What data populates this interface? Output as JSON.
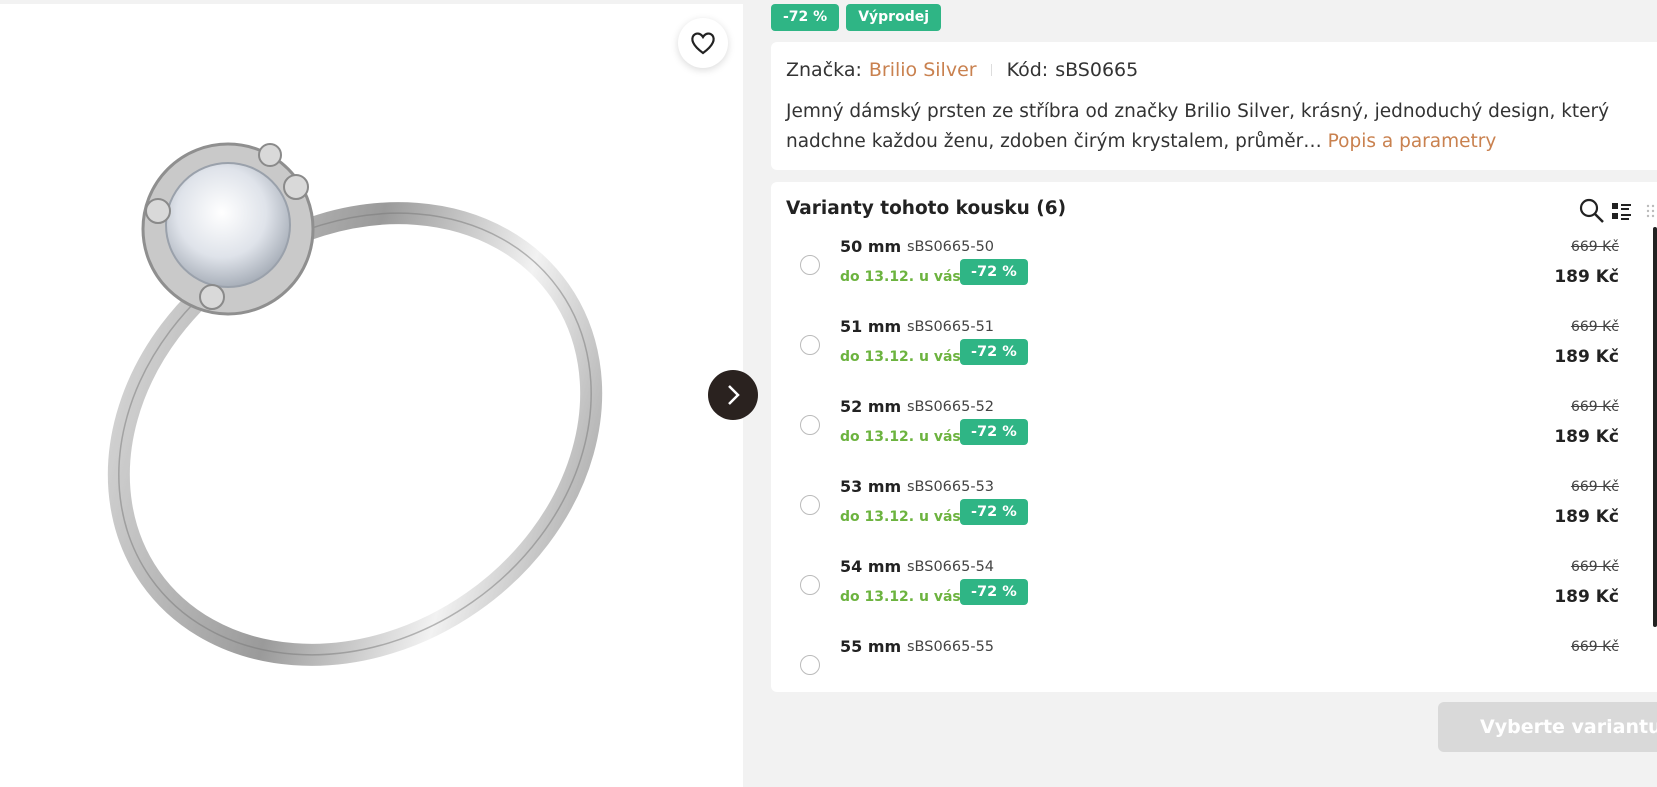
{
  "badges": [
    "-72 %",
    "Výprodej"
  ],
  "product": {
    "brand_label": "Značka:",
    "brand_name": "Brilio Silver",
    "code_label": "Kód:",
    "code_value": "sBS0665",
    "description": "Jemný dámský prsten ze stříbra od značky Brilio Silver, krásný, jednoduchý design, který nadchne každou ženu, zdoben čirým krystalem, průměr…",
    "description_link": "Popis a parametry"
  },
  "icons": {
    "favorite": "heart-icon",
    "next": "chevron-right-icon",
    "search": "search-icon",
    "list_view": "list-view-icon",
    "grid_view": "grid-view-icon"
  },
  "colors": {
    "accent_green": "#2fb585",
    "delivery_green": "#6cb33f",
    "link_brown": "#c9814f",
    "dark_button": "#2a221f"
  },
  "variants": {
    "title": "Varianty tohoto kousku (6)",
    "items": [
      {
        "size": "50 mm",
        "code": "sBS0665-50",
        "delivery": "do 13.12. u vás",
        "discount": "-72 %",
        "old_price": "669 Kč",
        "price": "189 Kč"
      },
      {
        "size": "51 mm",
        "code": "sBS0665-51",
        "delivery": "do 13.12. u vás",
        "discount": "-72 %",
        "old_price": "669 Kč",
        "price": "189 Kč"
      },
      {
        "size": "52 mm",
        "code": "sBS0665-52",
        "delivery": "do 13.12. u vás",
        "discount": "-72 %",
        "old_price": "669 Kč",
        "price": "189 Kč"
      },
      {
        "size": "53 mm",
        "code": "sBS0665-53",
        "delivery": "do 13.12. u vás",
        "discount": "-72 %",
        "old_price": "669 Kč",
        "price": "189 Kč"
      },
      {
        "size": "54 mm",
        "code": "sBS0665-54",
        "delivery": "do 13.12. u vás",
        "discount": "-72 %",
        "old_price": "669 Kč",
        "price": "189 Kč"
      },
      {
        "size": "55 mm",
        "code": "sBS0665-55",
        "delivery": "",
        "discount": "",
        "old_price": "669 Kč",
        "price": ""
      }
    ]
  },
  "submit_label": "Vyberte variantu"
}
